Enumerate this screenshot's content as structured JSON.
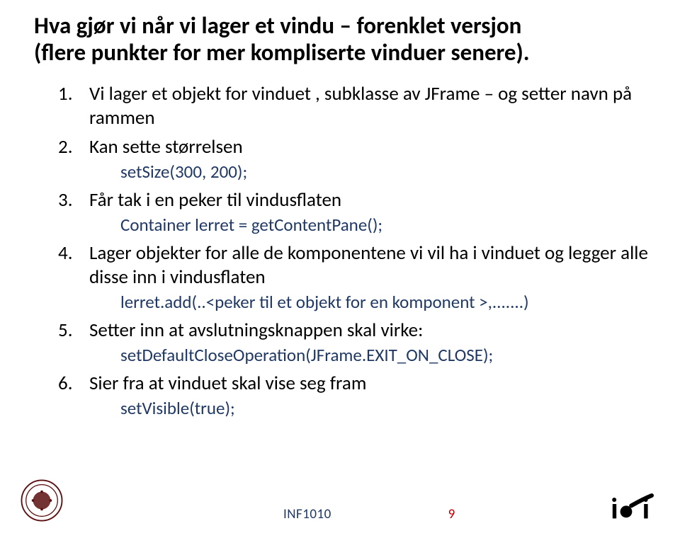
{
  "title_line1": "Hva gjør vi når vi lager et vindu –  forenklet versjon",
  "title_line2": "(flere punkter for mer kompliserte vinduer senere).",
  "items": [
    {
      "text": "Vi lager et objekt for vinduet , subklasse av JFrame   – og setter navn på rammen",
      "code": ""
    },
    {
      "text": "Kan sette størrelsen",
      "code": "setSize(300, 200);"
    },
    {
      "text": "Får tak i en peker til  vindusflaten",
      "code": "Container lerret = getContentPane();"
    },
    {
      "text": "Lager objekter for alle de komponentene vi vil ha i vinduet og legger alle disse inn i  vindusflaten",
      "code": "lerret.add(..<peker til et objekt for en komponent >,.......)"
    },
    {
      "text": "Setter inn at avslutningsknappen skal virke:",
      "code": "setDefaultCloseOperation(JFrame.EXIT_ON_CLOSE);"
    },
    {
      "text": "Sier fra at vinduet skal vise seg fram",
      "code": "setVisible(true);"
    }
  ],
  "footer_course": "INF1010",
  "footer_page": "9"
}
